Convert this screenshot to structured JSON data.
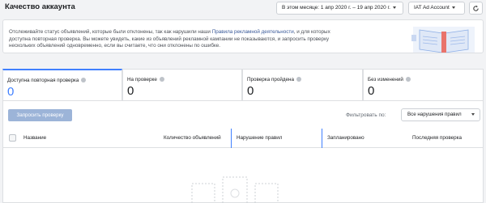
{
  "header": {
    "title": "Качество аккаунта",
    "date_range": "В этом месяце: 1 апр 2020 г. – 19 апр 2020 г.",
    "account": "IAT Ad Account",
    "refresh_icon": "refresh-icon"
  },
  "info": {
    "text_before": "Отслеживайте статус объявлений, которые были отклонены, так как нарушили наши ",
    "link": "Правила рекламной деятельности",
    "text_after": ", и для которых доступна повторная проверка. Вы можете увидеть, какие из объявлений рекламной кампании не показываются, и запросить проверку нескольких объявлений одновременно, если вы считаете, что они отклонены по ошибке."
  },
  "stats": [
    {
      "label": "Доступна повторная проверка",
      "value": "0"
    },
    {
      "label": "На проверке",
      "value": "0"
    },
    {
      "label": "Проверка пройдена",
      "value": "0"
    },
    {
      "label": "Без изменений",
      "value": "0"
    }
  ],
  "toolbar": {
    "request_review": "Запросить проверку",
    "filter_label": "Фильтровать по:",
    "filter_value": "Все нарушения правил"
  },
  "table": {
    "columns": [
      "Название",
      "Количество объявлений",
      "Нарушение правил",
      "Запланировано",
      "Последняя проверка"
    ]
  },
  "colors": {
    "accent": "#4080ff",
    "disabled_button": "#9cb4d8",
    "background": "#f2f3f5"
  }
}
